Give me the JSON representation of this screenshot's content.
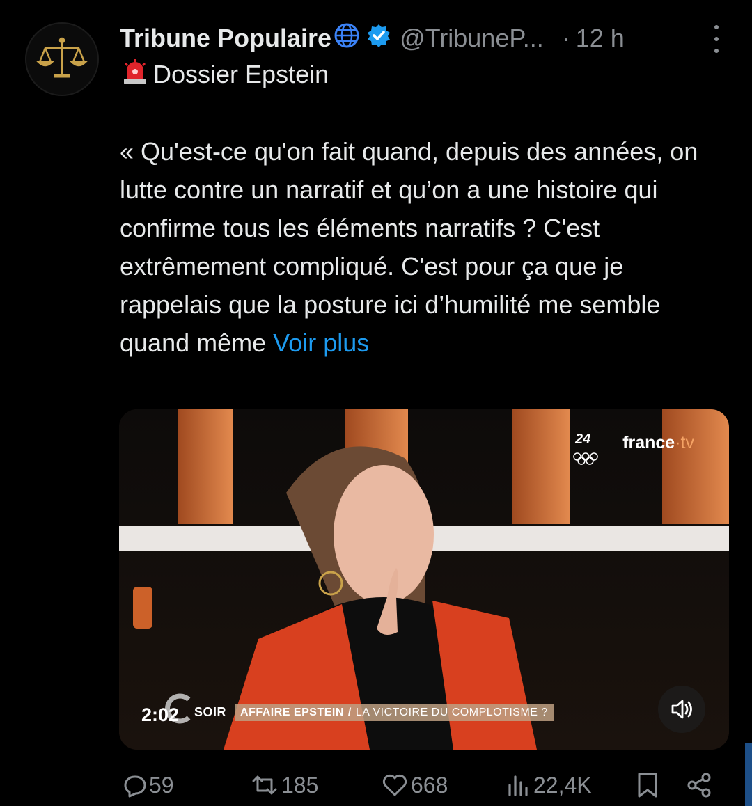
{
  "post": {
    "author_name": "Tribune Populaire",
    "author_handle": "@TribuneP...",
    "separator": "·",
    "time_ago": "12 h",
    "header_line": "Dossier Epstein",
    "body_text": "« Qu'est-ce qu'on fait quand, depuis des années, on lutte contre un narratif et qu’on a une histoire qui confirme tous les éléments narratifs ? C'est extrêmement compliqué. C'est pour ça que je rappelais que la posture ici d’humilité me semble quand même",
    "more_link": "Voir plus"
  },
  "media": {
    "duration": "2:02",
    "channel_logo_text": "france",
    "channel_logo_suffix": "·tv",
    "olympic_text": "24",
    "ticker_show": "SOIR",
    "ticker_topic": "AFFAIRE EPSTEIN",
    "ticker_slash": "/",
    "ticker_subtitle": "LA VICTOIRE DU COMPLOTISME ?"
  },
  "actions": {
    "replies": "59",
    "reposts": "185",
    "likes": "668",
    "views": "22,4K"
  },
  "colors": {
    "background": "#000000",
    "text": "#e7e9ea",
    "muted": "#8b8f94",
    "link": "#1d9bf0",
    "verified": "#1d9bf0"
  }
}
